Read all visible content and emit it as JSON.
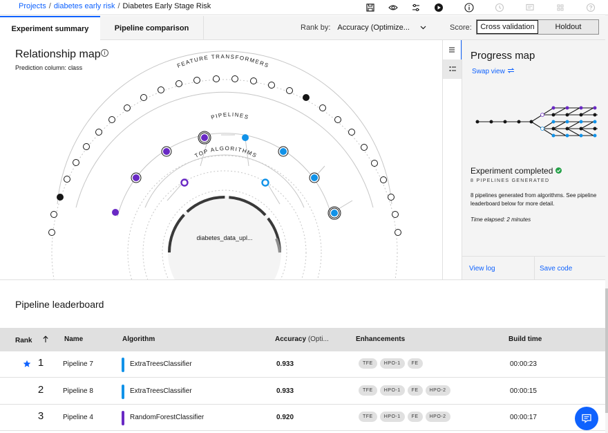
{
  "breadcrumb": {
    "projects": "Projects",
    "project": "diabetes early risk",
    "current": "Diabetes Early Stage Risk"
  },
  "toolbar_icons": [
    "save-icon",
    "view-icon",
    "settings-icon",
    "run-icon",
    "info-icon",
    "history-icon",
    "notes-icon",
    "code-icon",
    "help-icon"
  ],
  "tabs": {
    "summary": "Experiment summary",
    "comparison": "Pipeline comparison"
  },
  "rank_by": {
    "label": "Rank by:",
    "value": "Accuracy (Optimize..."
  },
  "score": {
    "label": "Score:",
    "cross_validation": "Cross validation",
    "holdout": "Holdout"
  },
  "relationship_map": {
    "title": "Relationship map",
    "prediction_label": "Prediction column:",
    "prediction_value": "class",
    "ring_feature": "FEATURE TRANSFORMERS",
    "ring_pipelines": "PIPELINES",
    "ring_algorithms": "TOP ALGORITHMS",
    "center_label": "diabetes_data_upl..."
  },
  "progress_map": {
    "title": "Progress map",
    "swap_view": "Swap view",
    "status": "Experiment completed",
    "generated": "8 PIPELINES GENERATED",
    "description": "8 pipelines generated from algorithms. See pipeline leaderboard below for more detail.",
    "elapsed": "Time elapsed: 2 minutes",
    "view_log": "View log",
    "save_code": "Save code"
  },
  "leaderboard": {
    "title": "Pipeline leaderboard",
    "headers": {
      "rank": "Rank",
      "name": "Name",
      "algorithm": "Algorithm",
      "accuracy": "Accuracy",
      "accuracy_sub": "(Opti...",
      "enhancements": "Enhancements",
      "build_time": "Build time"
    },
    "rows": [
      {
        "rank": "1",
        "name": "Pipeline 7",
        "algorithm": "ExtraTreesClassifier",
        "algo_color": "#1192e8",
        "accuracy": "0.933",
        "enhancements": [
          "TFE",
          "HPO-1",
          "FE"
        ],
        "build_time": "00:00:23",
        "starred": true
      },
      {
        "rank": "2",
        "name": "Pipeline 8",
        "algorithm": "ExtraTreesClassifier",
        "algo_color": "#1192e8",
        "accuracy": "0.933",
        "enhancements": [
          "TFE",
          "HPO-1",
          "FE",
          "HPO-2"
        ],
        "build_time": "00:00:15",
        "starred": false
      },
      {
        "rank": "3",
        "name": "Pipeline 4",
        "algorithm": "RandomForestClassifier",
        "algo_color": "#6929c4",
        "accuracy": "0.920",
        "enhancements": [
          "TFE",
          "HPO-1",
          "FE",
          "HPO-2"
        ],
        "build_time": "00:00:17",
        "starred": false
      }
    ]
  },
  "colors": {
    "accent": "#0f62fe",
    "extra_trees": "#1192e8",
    "random_forest": "#6929c4",
    "success": "#24a148"
  }
}
